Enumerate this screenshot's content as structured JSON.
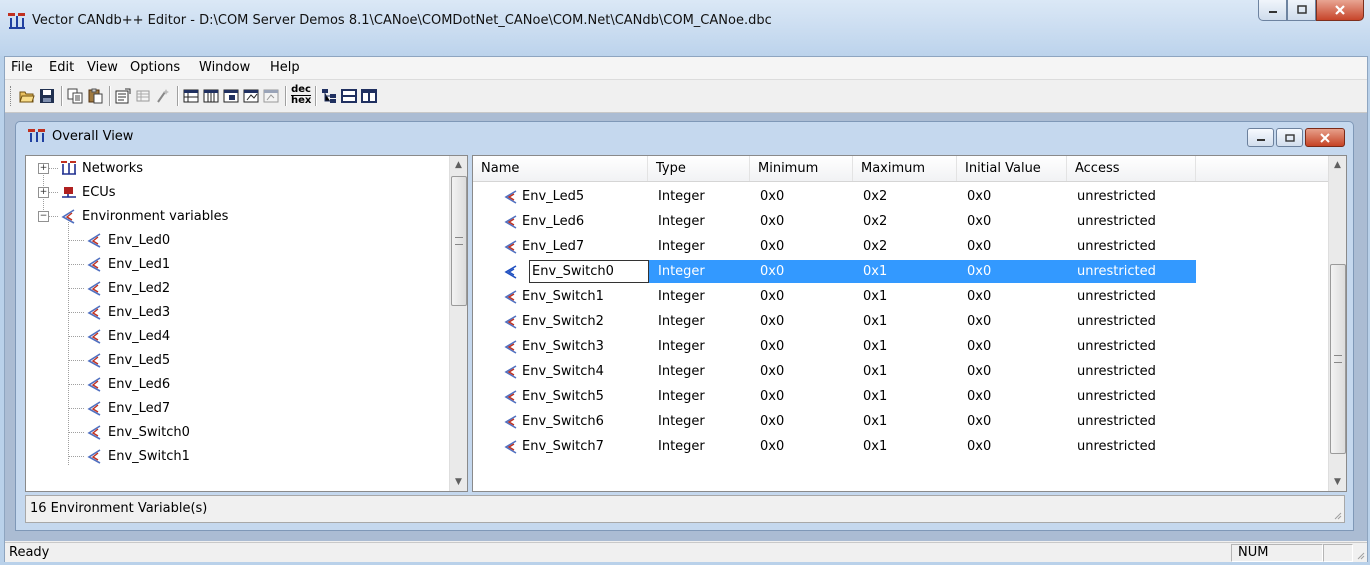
{
  "window": {
    "title": "Vector CANdb++ Editor - D:\\COM Server Demos 8.1\\CANoe\\COMDotNet_CANoe\\COM.Net\\CANdb\\COM_CANoe.dbc"
  },
  "menu": [
    "File",
    "Edit",
    "View",
    "Options",
    "Window",
    "Help"
  ],
  "toolbar": {
    "icons": [
      "open-icon",
      "save-icon",
      "copy-icon",
      "paste-icon",
      "properties-icon",
      "grid-icon",
      "wizard-icon",
      "view-1-icon",
      "view-2-icon",
      "view-3-icon",
      "view-4-icon",
      "view-5-icon",
      "dec-hex-icon",
      "tree-icon",
      "split-horizontal-icon",
      "split-vertical-icon"
    ],
    "dec_hex_label_top": "dec",
    "dec_hex_label_bottom": "hex"
  },
  "child_window": {
    "title": "Overall View",
    "status": "16 Environment Variable(s)"
  },
  "tree": {
    "networks": "Networks",
    "ecus": "ECUs",
    "env_vars": "Environment variables",
    "items": [
      "Env_Led0",
      "Env_Led1",
      "Env_Led2",
      "Env_Led3",
      "Env_Led4",
      "Env_Led5",
      "Env_Led6",
      "Env_Led7",
      "Env_Switch0",
      "Env_Switch1"
    ]
  },
  "table": {
    "columns": [
      "Name",
      "Type",
      "Minimum",
      "Maximum",
      "Initial Value",
      "Access"
    ],
    "rows": [
      {
        "name": "Env_Led5",
        "type": "Integer",
        "min": "0x0",
        "max": "0x2",
        "init": "0x0",
        "access": "unrestricted"
      },
      {
        "name": "Env_Led6",
        "type": "Integer",
        "min": "0x0",
        "max": "0x2",
        "init": "0x0",
        "access": "unrestricted"
      },
      {
        "name": "Env_Led7",
        "type": "Integer",
        "min": "0x0",
        "max": "0x2",
        "init": "0x0",
        "access": "unrestricted"
      },
      {
        "name": "Env_Switch0",
        "type": "Integer",
        "min": "0x0",
        "max": "0x1",
        "init": "0x0",
        "access": "unrestricted"
      },
      {
        "name": "Env_Switch1",
        "type": "Integer",
        "min": "0x0",
        "max": "0x1",
        "init": "0x0",
        "access": "unrestricted"
      },
      {
        "name": "Env_Switch2",
        "type": "Integer",
        "min": "0x0",
        "max": "0x1",
        "init": "0x0",
        "access": "unrestricted"
      },
      {
        "name": "Env_Switch3",
        "type": "Integer",
        "min": "0x0",
        "max": "0x1",
        "init": "0x0",
        "access": "unrestricted"
      },
      {
        "name": "Env_Switch4",
        "type": "Integer",
        "min": "0x0",
        "max": "0x1",
        "init": "0x0",
        "access": "unrestricted"
      },
      {
        "name": "Env_Switch5",
        "type": "Integer",
        "min": "0x0",
        "max": "0x1",
        "init": "0x0",
        "access": "unrestricted"
      },
      {
        "name": "Env_Switch6",
        "type": "Integer",
        "min": "0x0",
        "max": "0x1",
        "init": "0x0",
        "access": "unrestricted"
      },
      {
        "name": "Env_Switch7",
        "type": "Integer",
        "min": "0x0",
        "max": "0x1",
        "init": "0x0",
        "access": "unrestricted"
      }
    ],
    "selected_row": 3
  },
  "status": {
    "text": "Ready",
    "num": "NUM"
  },
  "colors": {
    "selection": "#3399ff",
    "title_gradient_top": "#dbe8f6",
    "close_red": "#c7452a"
  }
}
